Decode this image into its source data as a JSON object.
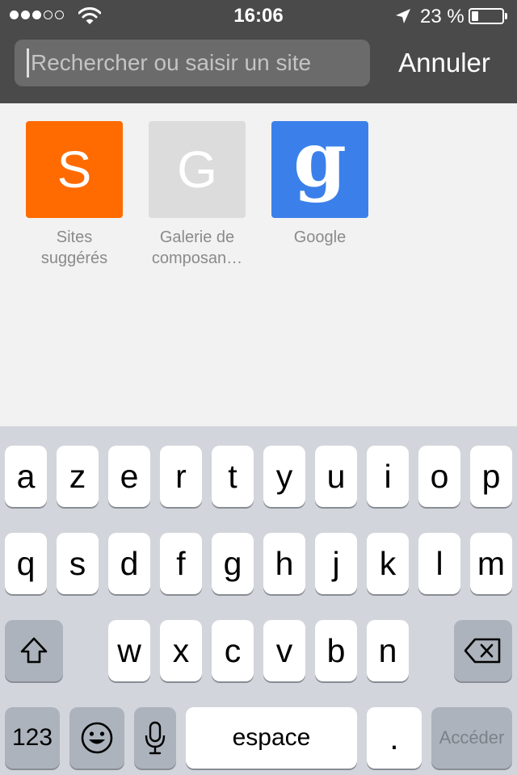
{
  "status_bar": {
    "signal_filled": 3,
    "signal_empty": 2,
    "time": "16:06",
    "battery_text": "23 %",
    "battery_level": 0.23,
    "icons": [
      "signal-dots-icon",
      "wifi-icon",
      "location-arrow-icon",
      "battery-icon"
    ]
  },
  "search": {
    "placeholder": "Rechercher ou saisir un site",
    "value": ""
  },
  "cancel_label": "Annuler",
  "favorites": [
    {
      "letter": "S",
      "line1": "Sites",
      "line2": "suggérés",
      "color": "#ff6b00"
    },
    {
      "letter": "G",
      "line1": "Galerie de",
      "line2": "composan…",
      "color": "#dcdcdc"
    },
    {
      "letter": "g",
      "line1": "Google",
      "line2": "",
      "color": "#3b80ea"
    }
  ],
  "keyboard": {
    "row1": [
      "a",
      "z",
      "e",
      "r",
      "t",
      "y",
      "u",
      "i",
      "o",
      "p"
    ],
    "row2": [
      "q",
      "s",
      "d",
      "f",
      "g",
      "h",
      "j",
      "k",
      "l",
      "m"
    ],
    "row3": [
      "w",
      "x",
      "c",
      "v",
      "b",
      "n"
    ],
    "numbers_label": "123",
    "space_label": "espace",
    "period_label": ".",
    "go_label": "Accéder",
    "icons": [
      "shift-icon",
      "delete-icon",
      "emoji-icon",
      "microphone-icon"
    ]
  },
  "colors": {
    "toolbar": "#4a4a4a",
    "search_field": "#6b6b6b",
    "keyboard_bg": "#d2d5db",
    "special_key": "#acb3bc"
  }
}
